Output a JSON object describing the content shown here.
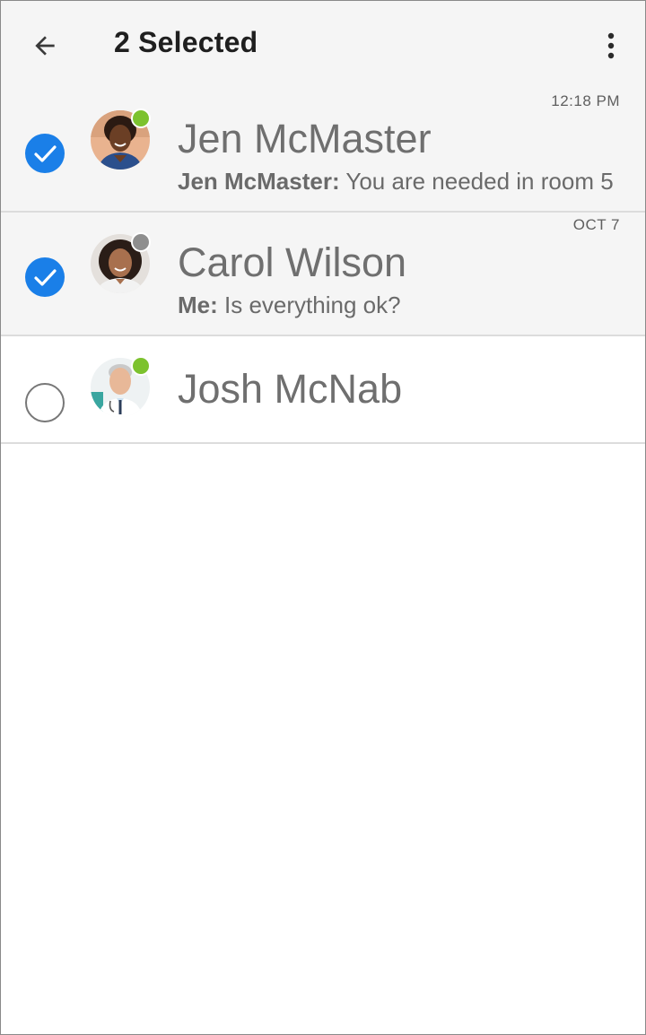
{
  "header": {
    "title": "2 Selected",
    "back_icon": "arrow-left-icon",
    "menu_icon": "more-vertical-icon"
  },
  "conversations": [
    {
      "name": "Jen McMaster",
      "time": "12:18 PM",
      "preview_sender": "Jen McMaster:",
      "preview_text": "You are needed in room 5",
      "selected": true,
      "presence": "online",
      "presence_color": "#7cc22e"
    },
    {
      "name": "Carol Wilson",
      "time": "OCT 7",
      "preview_sender": "Me:",
      "preview_text": "Is everything ok?",
      "selected": true,
      "presence": "away",
      "presence_color": "#8e8e8e"
    },
    {
      "name": "Josh McNab",
      "time": "",
      "preview_sender": "",
      "preview_text": "",
      "selected": false,
      "presence": "online",
      "presence_color": "#7cc22e"
    }
  ],
  "colors": {
    "accent": "#1a7fe8",
    "header_bg": "#f5f5f5",
    "selected_row_bg": "#f5f5f5"
  }
}
